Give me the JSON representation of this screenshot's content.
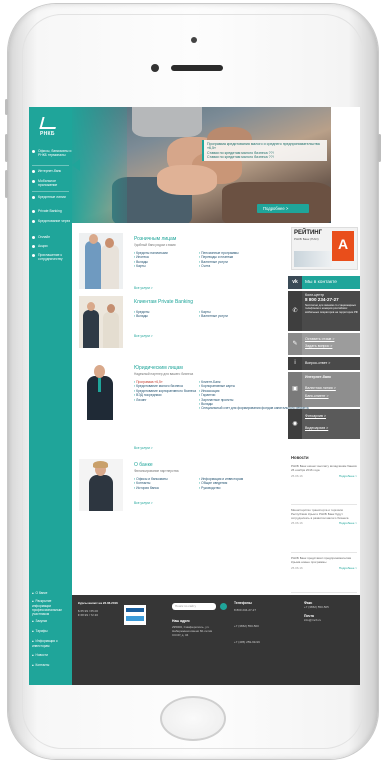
{
  "sidebar": {
    "logo_text": "РНКБ",
    "items": [
      {
        "label": "Офисы, банкоматы и РНКБ терминалы"
      },
      {
        "label": "Интернет-банк"
      },
      {
        "label": "Мобильное приложение"
      },
      {
        "label": "Кредитные линии"
      },
      {
        "label": "Private Banking"
      },
      {
        "label": "Кредитование через"
      },
      {
        "label": "Онлайн"
      },
      {
        "label": "Акции"
      },
      {
        "label": "Приглашение к сотрудничеству"
      }
    ],
    "bottom_items": [
      {
        "label": "О банке"
      },
      {
        "label": "Раскрытие информации профессиональным участником"
      },
      {
        "label": "Закупки"
      },
      {
        "label": "Тарифы"
      },
      {
        "label": "Информация о инвесторам"
      },
      {
        "label": "Новости"
      },
      {
        "label": "Контакты"
      }
    ]
  },
  "banner": {
    "caption_line1": "Программа кредитования малого и среднего предпринимательства «6,5»",
    "caption_line2": "Ставки по кредитам малого бизнеса ??!",
    "caption_line3": "Ставки по кредитам малого бизнеса ??!",
    "button_label": "Подробнее >"
  },
  "sections": [
    {
      "title": "Розничным лицам",
      "subtitle": "Удобный банк рядом с вами",
      "col1": [
        "Кредиты наличными",
        "Ипотека",
        "Вклады",
        "Карты"
      ],
      "col2": [
        "Пенсионные программы",
        "Переводы и платежи",
        "Валютные услуги",
        "Счета"
      ],
      "more": "Все услуги >"
    },
    {
      "title": "Клиентам Private Banking",
      "subtitle": "",
      "col1": [
        "Кредиты",
        "Вклады"
      ],
      "col2": [
        "Карты",
        "Валютные услуги"
      ],
      "more": "Все услуги >"
    },
    {
      "title": "Юридическим лицам",
      "subtitle": "Надежный партнер для вашего бизнеса",
      "col1": [
        "Программа «6,5»",
        "Кредитование малого бизнеса",
        "Кредитование корпоративного бизнеса",
        "ВЭД посредники",
        "Лизинг"
      ],
      "col2": [
        "Клиент-Банк",
        "Корпоративные карты",
        "Инкассация",
        "Гарантии",
        "Зарплатные проекты",
        "Вклады",
        "Специальный счет для формирования фондов капитального ремонта"
      ],
      "more": "Все услуги >"
    },
    {
      "title": "О банке",
      "subtitle": "Финансирование партнерства",
      "col1": [
        "Офисы и банкоматы",
        "Контакты",
        "История банка"
      ],
      "col2": [
        "Информация и инвесторам",
        "Общие сведения",
        "Руководство"
      ],
      "more": "Все услуги >"
    }
  ],
  "right_panel": {
    "rating_title": "РЕЙТИНГ",
    "rating_subtitle": "РНКБ Банк (ПАО)",
    "rating_badge": "А",
    "vk_icon": "vk",
    "vk_label": "Мы в контакте",
    "call_center_title": "Колл-центр",
    "call_center_phone": "8 800 234-27-27",
    "call_center_note": "бесплатно для звонков со стационарных телефонов и номеров российских мобильных операторов на территории РФ",
    "feedback_label": "Оставить отзыв >",
    "online_ask_label": "Задать вопрос >",
    "question_answer_label": "Вопрос-ответ >",
    "internet_bank_label": "Интернет-банк",
    "currency_label": "Валютная линия >",
    "bank_label": "Банк-клиент >",
    "photo_label": "Фотоархив >",
    "video_label": "Видеоархив >",
    "news_title": "Новости",
    "news": [
      {
        "text": "РНКБ Банк начнет выплату вкладчикам банков 26 ноября 2016 года",
        "date": "25.06.16",
        "more": "Подробнее >"
      },
      {
        "text": "Министерство транспорта и торговли Республики Крым и РНКБ Банк будут сотрудничать в развитии малого бизнеса",
        "date": "25.06.16",
        "more": "Подробнее >"
      },
      {
        "text": "РНКБ Банк представил предпринимателям Крыма новые программы",
        "date": "25.06.16",
        "more": "Подробнее >"
      }
    ]
  },
  "footer": {
    "hours_label": "Курсы валют на 22.06.2016",
    "rates": [
      "$ 65.99 / 65.00",
      "€ 68.99 / 72.30"
    ],
    "search_placeholder": "Поиск по сайту",
    "address_title": "Наш адрес",
    "address": "295000, Симферополь, ул. Набережная имени 60-летия СССР, д. 34",
    "phones_title": "Телефоны",
    "phones": [
      "8 800 234-27-27",
      "+7 (3652) 550-500",
      "+7 (495) 259-99-99"
    ],
    "mail_title": "Факс",
    "mail": "+7 (3652) 550-505",
    "email_title": "Почта",
    "email": "info@rncb.ru"
  },
  "colors": {
    "accent": "#1fa59a",
    "dark": "#363636",
    "banner_button": "#1fa59a"
  }
}
